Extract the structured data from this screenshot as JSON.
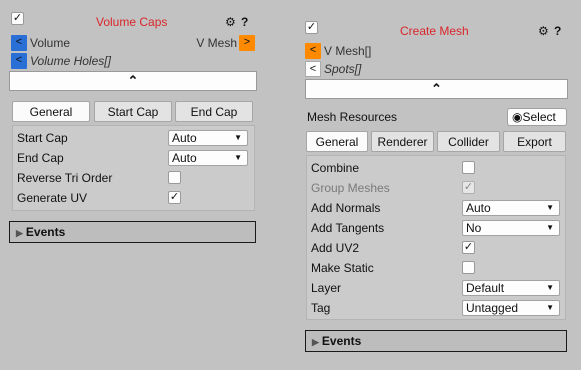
{
  "volume_caps": {
    "title": "Volume Caps",
    "volume_label": "Volume",
    "v_mesh_label": "V Mesh",
    "volume_holes_label": "Volume Holes[]",
    "tabs": [
      "General",
      "Start Cap",
      "End Cap"
    ],
    "active_tab": "General",
    "props": {
      "start_cap_label": "Start Cap",
      "start_cap_value": "Auto",
      "end_cap_label": "End Cap",
      "end_cap_value": "Auto",
      "reverse_tri_order_label": "Reverse Tri Order",
      "reverse_tri_order_checked": false,
      "generate_uv_label": "Generate UV",
      "generate_uv_checked": true
    },
    "events_label": "Events"
  },
  "create_mesh": {
    "title": "Create Mesh",
    "v_mesh_label": "V Mesh[]",
    "spots_label": "Spots[]",
    "mesh_resources_label": "Mesh Resources",
    "select_label": "Select",
    "tabs": [
      "General",
      "Renderer",
      "Collider",
      "Export"
    ],
    "active_tab": "General",
    "props": {
      "combine_label": "Combine",
      "combine_checked": false,
      "group_meshes_label": "Group Meshes",
      "group_meshes_checked": true,
      "add_normals_label": "Add Normals",
      "add_normals_value": "Auto",
      "add_tangents_label": "Add Tangents",
      "add_tangents_value": "No",
      "add_uv2_label": "Add UV2",
      "add_uv2_checked": true,
      "make_static_label": "Make Static",
      "make_static_checked": false,
      "layer_label": "Layer",
      "layer_value": "Default",
      "tag_label": "Tag",
      "tag_value": "Untagged"
    },
    "events_label": "Events"
  },
  "icons": {
    "gear": "⚙",
    "help": "❓",
    "arrow_left": "<",
    "arrow_right": ">",
    "chevron_up": "⌃",
    "check": "✓",
    "caret_down": "▼",
    "triangle_right": "▶",
    "radio": "◉"
  },
  "colors": {
    "title_red": "#d9262b",
    "link_blue": "#2a6fd6",
    "link_orange": "#ff8a00",
    "background": "#c2c2c2"
  }
}
